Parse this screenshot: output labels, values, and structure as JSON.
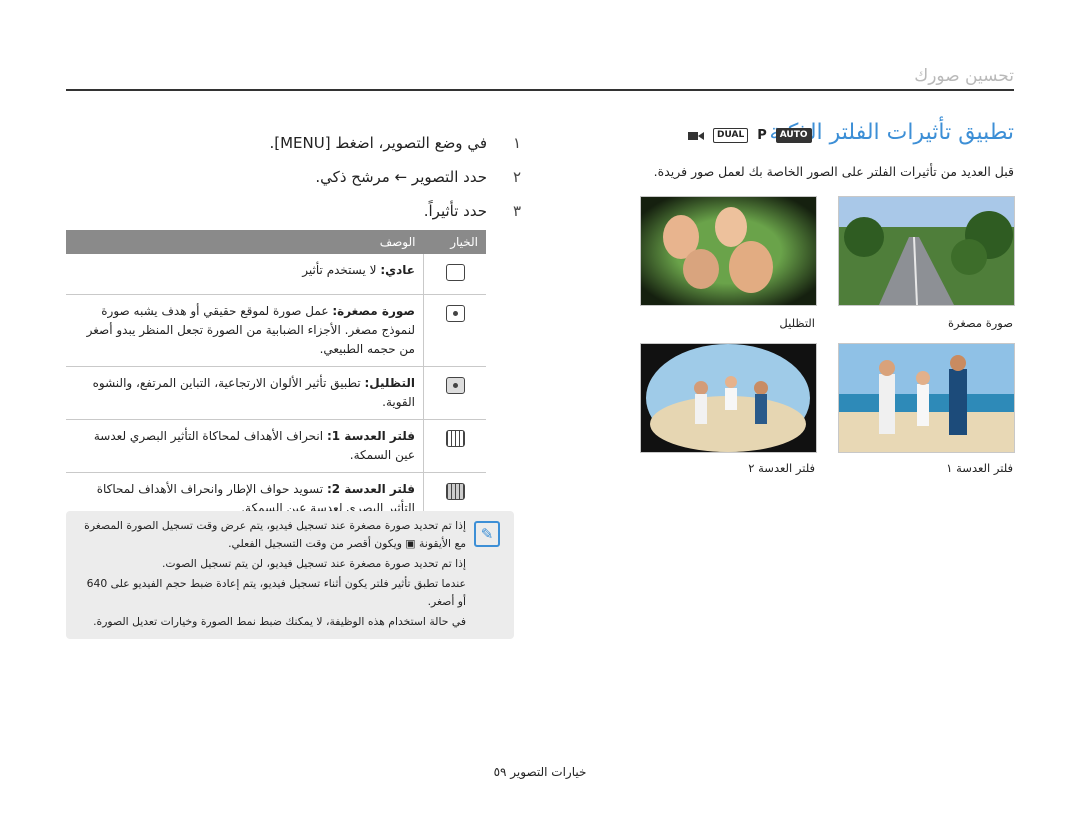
{
  "section_title": "تحسين صورك",
  "main_title": "تطبيق تأثيرات الفلتر الذكية",
  "mode_icons": {
    "auto": "AUTO",
    "p": "P",
    "dual": "DUAL",
    "movie": "movie-icon"
  },
  "intro": "قبل العديد من تأثيرات الفلتر على الصور الخاصة بك لعمل صور فريدة.",
  "photos": [
    {
      "caption": "صورة مصغرة",
      "name": "road"
    },
    {
      "caption": "التظليل",
      "name": "family-faces"
    },
    {
      "caption": "فلتر العدسة ١",
      "name": "beach-family"
    },
    {
      "caption": "فلتر العدسة ٢",
      "name": "fisheye-family"
    }
  ],
  "steps": [
    {
      "num": "١",
      "text": "في وضع التصوير، اضغط [MENU]."
    },
    {
      "num": "٢",
      "text": "حدد التصوير ← مرشح ذكي."
    },
    {
      "num": "٣",
      "text": "حدد تأثيراً."
    }
  ],
  "table": {
    "header_option": "الخيار",
    "header_desc": "الوصف",
    "rows": [
      {
        "icon": "normal-icon",
        "name": "عادي:",
        "desc": "لا يستخدم تأثير"
      },
      {
        "icon": "miniature-icon",
        "name": "صورة مصغرة:",
        "desc": "عمل صورة لموقع حقيقي أو هدف يشبه صورة لنموذج مصغر. الأجزاء الضبابية من الصورة تجعل المنظر يبدو أصغر من حجمه الطبيعي."
      },
      {
        "icon": "vignetting-icon",
        "name": "التظليل:",
        "desc": "تطبيق تأثير الألوان الارتجاعية، التباين المرتفع، والنشوه القوية."
      },
      {
        "icon": "lens1-icon",
        "name": "فلتر العدسة 1:",
        "desc": "انحراف الأهداف لمحاكاة التأثير البصري لعدسة عين السمكة."
      },
      {
        "icon": "lens2-icon",
        "name": "فلتر العدسة 2:",
        "desc": "تسويد حواف الإطار وانحراف الأهداف لمحاكاة التأثير البصري لعدسة عين السمكة."
      }
    ]
  },
  "notes": [
    "إذا تم تحديد صورة مصغرة عند تسجيل فيديو، يتم عرض وقت تسجيل الصورة المصغرة",
    "مع الأيقونة ▣ ويكون أقصر من وقت التسجيل الفعلي.",
    "إذا تم تحديد صورة مصغرة عند تسجيل فيديو، لن يتم تسجيل الصوت.",
    "عندما تطبق تأثير فلتر يكون أثناء تسجيل فيديو، يتم إعادة ضبط حجم الفيديو على 640",
    "أو أصغر.",
    "في حالة استخدام هذه الوظيفة، لا يمكنك ضبط نمط الصورة وخيارات تعديل الصورة."
  ],
  "footer": "خيارات التصوير ٥٩"
}
